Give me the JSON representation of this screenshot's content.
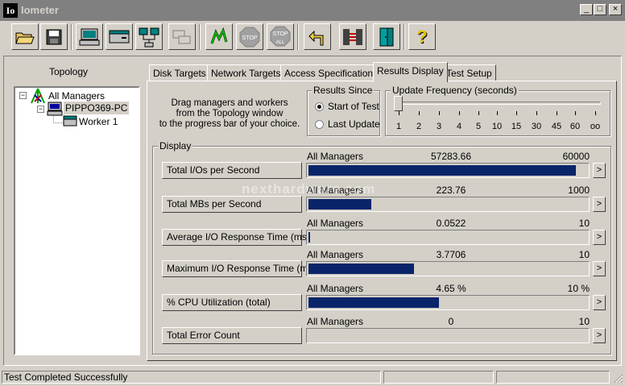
{
  "window": {
    "app_icon_text": "Io",
    "title": "Iometer",
    "controls": [
      "_",
      "□",
      "×"
    ]
  },
  "toolbar": {
    "buttons": [
      {
        "icon": "open-folder-icon"
      },
      {
        "icon": "save-disk-icon"
      },
      {
        "icon": "computer-icon"
      },
      {
        "icon": "disk-drive-icon"
      },
      {
        "icon": "network-icon"
      },
      {
        "icon": "copy-worker-icon"
      },
      {
        "icon": "start-green-flag-icon"
      },
      {
        "icon": "stop-icon",
        "label": "STOP"
      },
      {
        "icon": "stop-all-icon",
        "label": "STOP",
        "sublabel": "ALL"
      },
      {
        "icon": "reset-arrow-icon"
      },
      {
        "icon": "disconnect-icon"
      },
      {
        "icon": "exit-door-icon"
      },
      {
        "icon": "help-icon",
        "label": "?"
      }
    ]
  },
  "topology": {
    "title": "Topology",
    "root": "All Managers",
    "manager": "PIPPO369-PC",
    "worker": "Worker 1"
  },
  "tabs": [
    "Disk Targets",
    "Network Targets",
    "Access Specifications",
    "Results Display",
    "Test Setup"
  ],
  "active_tab": "Results Display",
  "instructions": [
    "Drag managers and workers",
    "from the Topology window",
    "to the progress bar of your choice."
  ],
  "results_since": {
    "title": "Results Since",
    "options": [
      "Start of Test",
      "Last Update"
    ],
    "selected": "Start of Test"
  },
  "update_frequency": {
    "title": "Update Frequency (seconds)",
    "ticks": [
      "1",
      "2",
      "3",
      "4",
      "5",
      "10",
      "15",
      "30",
      "45",
      "60",
      "oo"
    ],
    "selected": "1"
  },
  "display": {
    "title": "Display",
    "rows": [
      {
        "label": "Total I/Os per Second",
        "source": "All Managers",
        "value": "57283.66",
        "max": "60000",
        "fraction": 0.9547
      },
      {
        "label": "Total MBs per Second",
        "source": "All Managers",
        "value": "223.76",
        "max": "1000",
        "fraction": 0.2238
      },
      {
        "label": "Average I/O Response Time (ms)",
        "source": "All Managers",
        "value": "0.0522",
        "max": "10",
        "fraction": 0.0052
      },
      {
        "label": "Maximum I/O Response Time (ms)",
        "source": "All Managers",
        "value": "3.7706",
        "max": "10",
        "fraction": 0.3771
      },
      {
        "label": "% CPU Utilization (total)",
        "source": "All Managers",
        "value": "4.65 %",
        "max": "10 %",
        "fraction": 0.465
      },
      {
        "label": "Total Error Count",
        "source": "All Managers",
        "value": "0",
        "max": "10",
        "fraction": 0
      }
    ],
    "arrow": ">"
  },
  "status": {
    "message": "Test Completed Successfully"
  },
  "watermark": "nexthardware.com",
  "colors": {
    "bar_fill": "#0a246a",
    "face": "#d4d0c8",
    "title_inactive": "#808080"
  }
}
